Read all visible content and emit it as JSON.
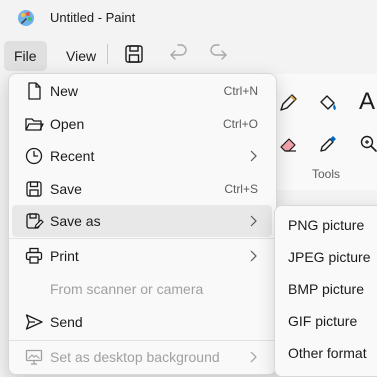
{
  "window": {
    "title": "Untitled - Paint"
  },
  "menubar": {
    "file": "File",
    "view": "View"
  },
  "toolbar": {
    "icons": [
      "save-icon",
      "undo-icon",
      "redo-icon"
    ]
  },
  "ribbon": {
    "tools_label": "Tools",
    "text_glyph": "A"
  },
  "file_menu": {
    "new": {
      "label": "New",
      "shortcut": "Ctrl+N"
    },
    "open": {
      "label": "Open",
      "shortcut": "Ctrl+O"
    },
    "recent": {
      "label": "Recent"
    },
    "save": {
      "label": "Save",
      "shortcut": "Ctrl+S"
    },
    "save_as": {
      "label": "Save as"
    },
    "print": {
      "label": "Print"
    },
    "scanner": {
      "label": "From scanner or camera"
    },
    "send": {
      "label": "Send"
    },
    "desktop_bg": {
      "label": "Set as desktop background"
    }
  },
  "save_as_menu": {
    "png": "PNG picture",
    "jpeg": "JPEG picture",
    "bmp": "BMP picture",
    "gif": "GIF picture",
    "other": "Other format"
  },
  "colors": {
    "accent": "#0067c0",
    "hover": "#e8e8e8",
    "disabled": "#a0a0a0"
  }
}
